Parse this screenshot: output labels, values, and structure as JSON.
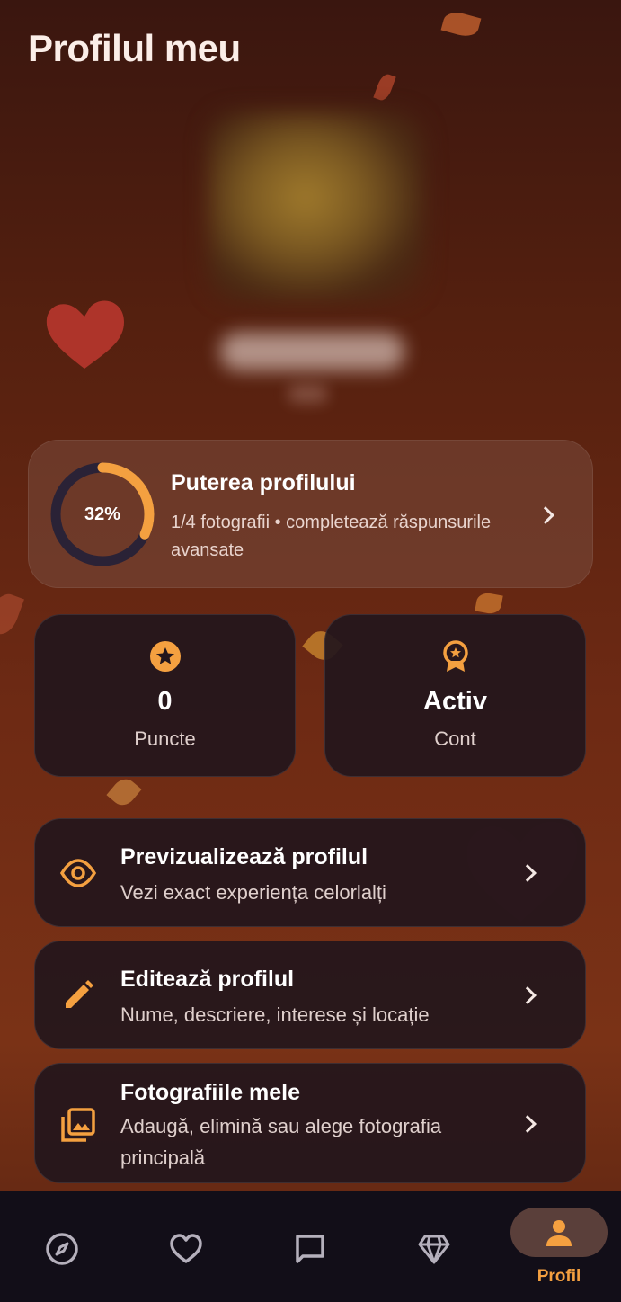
{
  "header": {
    "title": "Profilul meu"
  },
  "strength": {
    "title": "Puterea profilului",
    "percent_label": "32%",
    "percent_value": 0.32,
    "subtitle": "1/4 fotografii • completează răspunsurile avansate"
  },
  "stats": [
    {
      "value": "0",
      "label": "Puncte",
      "icon": "star-badge-icon"
    },
    {
      "value": "Activ",
      "label": "Cont",
      "icon": "award-ribbon-icon"
    }
  ],
  "menu": [
    {
      "title": "Previzualizează profilul",
      "subtitle": "Vezi exact experiența celorlalți",
      "icon": "eye-icon"
    },
    {
      "title": "Editează profilul",
      "subtitle": "Nume, descriere, interese și locație",
      "icon": "pencil-icon"
    },
    {
      "title": "Fotografiile mele",
      "subtitle": "Adaugă, elimină sau alege fotografia principală",
      "icon": "photo-library-icon"
    }
  ],
  "nav": {
    "items": [
      {
        "icon": "compass-icon"
      },
      {
        "icon": "heart-icon"
      },
      {
        "icon": "chat-icon"
      },
      {
        "icon": "diamond-icon"
      },
      {
        "icon": "person-icon",
        "label": "Profil",
        "active": true
      }
    ]
  },
  "colors": {
    "accent": "#F4A040",
    "ring_track": "#2A2236",
    "card_bg": "#23161C"
  }
}
